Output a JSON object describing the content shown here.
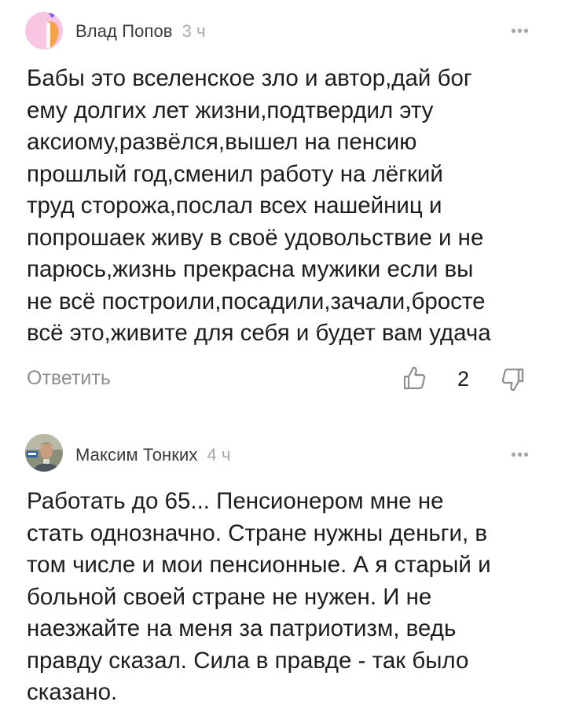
{
  "comments": [
    {
      "author": "Влад Попов",
      "time": "3 ч",
      "text": "Бабы это вселенское зло и автор,дай бог\nему долгих лет жизни,подтвердил эту\nаксиому,развёлся,вышел на пенсию\nпрошлый год,сменил работу на лёгкий\nтруд сторожа,послал всех нашейниц и\nпопрошаек живу в своё удовольствие и не\nпарюсь,жизнь прекрасна мужики если вы\nне всё построили,посадили,зачали,бросте\nвсё это,живите для себя и будет вам удача",
      "reply_label": "Ответить",
      "likes": "2",
      "avatar_colors": {
        "left": "#f6b3da",
        "right": "#f4a342",
        "dot": "#7a5af0"
      }
    },
    {
      "author": "Максим Тонких",
      "time": "4 ч",
      "text": "Работать до 65... Пенсионером мне не\nстать однозначно. Стране нужны деньги, в\nтом числе и мои пенсионные. А я старый и\nбольной своей стране не нужен. И не\nнаезжайте на меня за патриотизм, ведь\nправду сказал. Сила в правде - так было\nсказано."
    }
  ],
  "icons": {
    "more": "more-dots-icon",
    "like": "thumbs-up-icon",
    "dislike": "thumbs-down-icon"
  }
}
